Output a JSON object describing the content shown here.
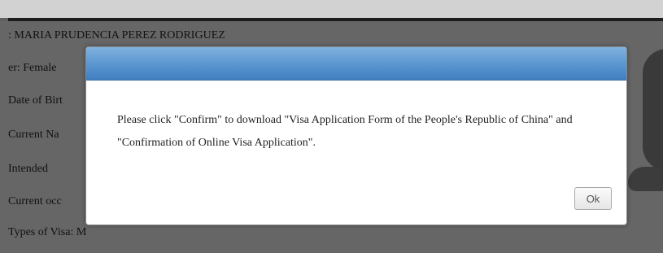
{
  "background": {
    "lines": [
      ": MARIA PRUDENCIA PEREZ RODRIGUEZ",
      "er: Female",
      "Date of Birt",
      "Current Na",
      "Intended",
      "Current occ",
      "Types of Visa: M"
    ]
  },
  "dialog": {
    "message": "Please click \"Confirm\" to download \"Visa Application Form of the People's Republic of China\" and \"Confirmation of Online Visa Application\".",
    "ok_label": "Ok"
  },
  "colors": {
    "titlebar": "#5a95cf",
    "overlay": "#616161"
  }
}
